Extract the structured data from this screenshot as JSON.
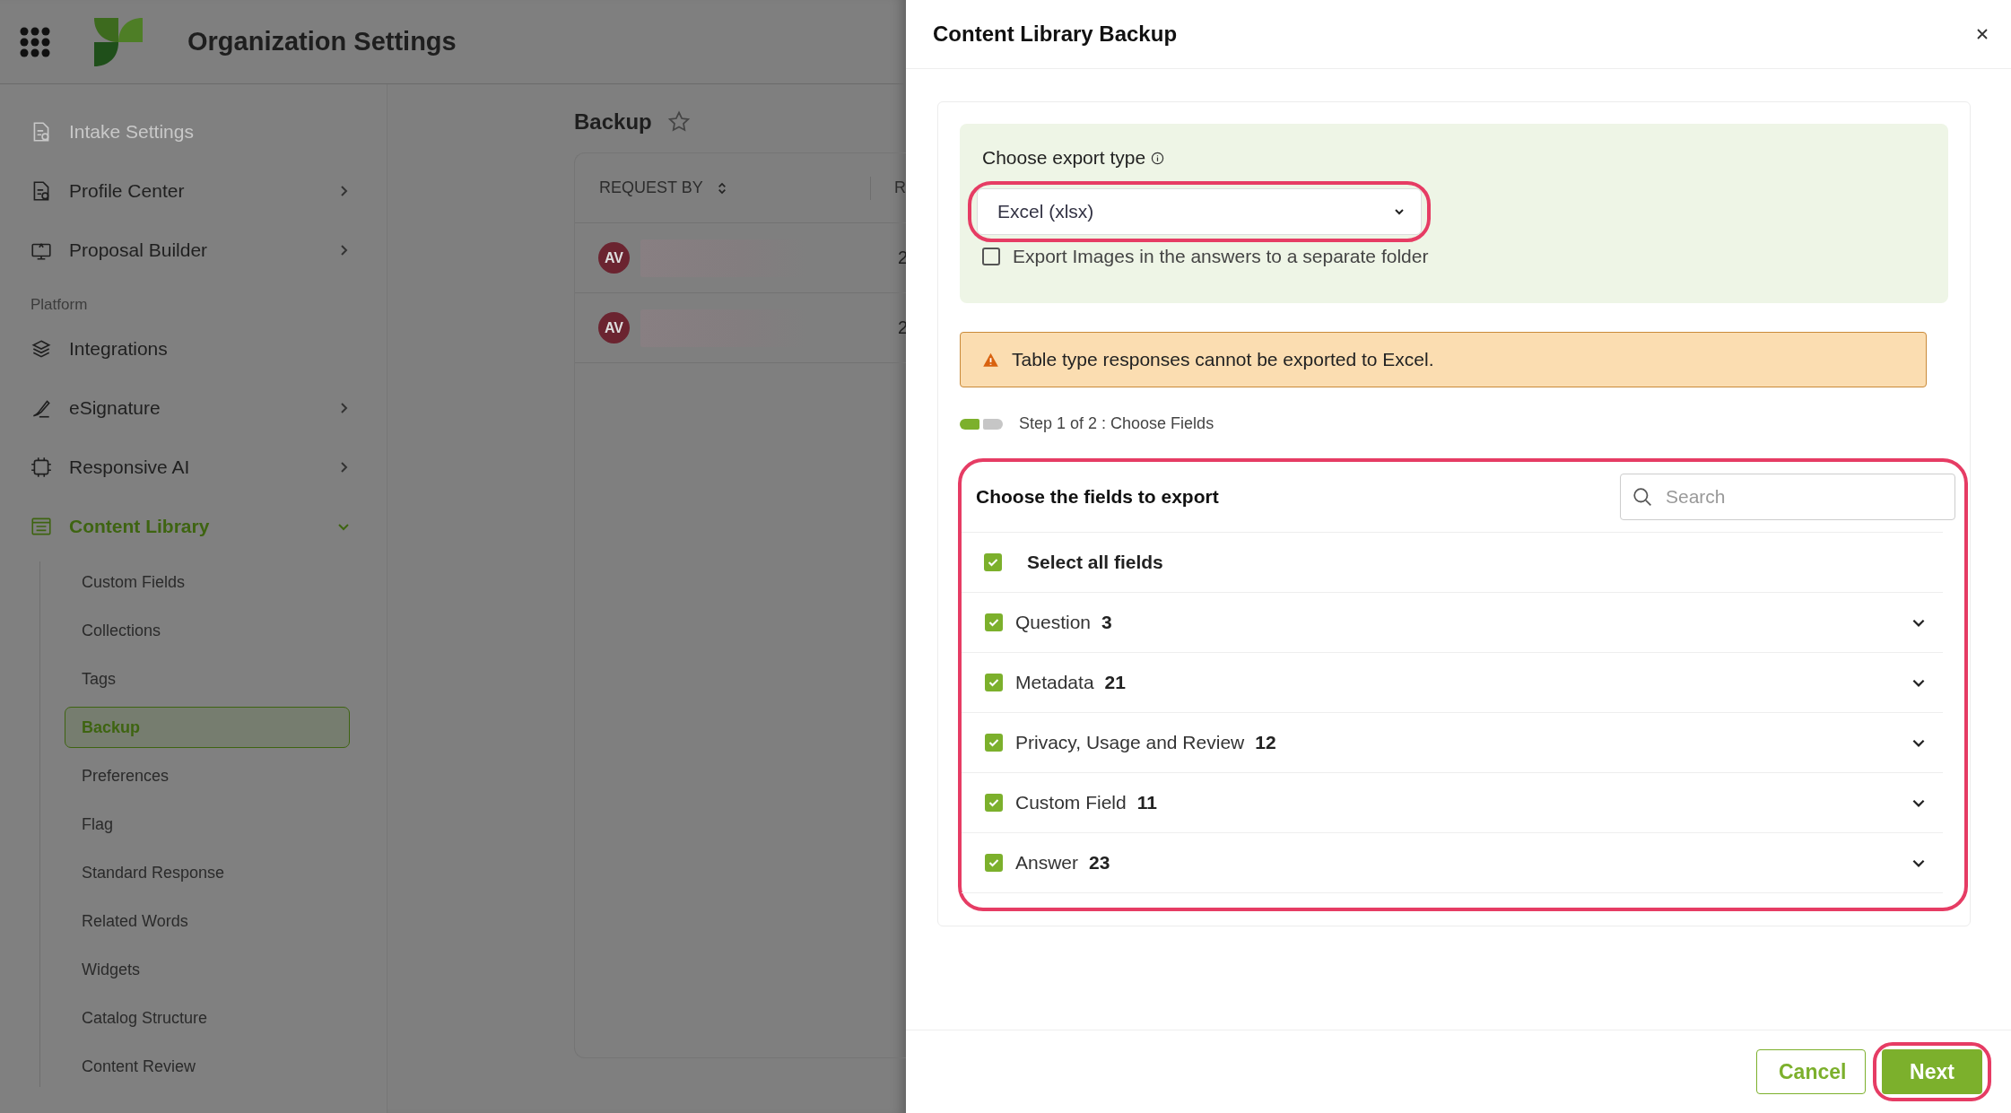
{
  "app_header": {
    "title": "Organization Settings"
  },
  "sidebar": {
    "items": [
      {
        "kind": "item",
        "label": "Intake Settings",
        "disabled": true,
        "expandable": false,
        "selected": false
      },
      {
        "kind": "item",
        "label": "Profile Center",
        "disabled": false,
        "expandable": true,
        "expanded": false,
        "selected": false
      },
      {
        "kind": "item",
        "label": "Proposal Builder",
        "disabled": false,
        "expandable": true,
        "expanded": false,
        "selected": false
      },
      {
        "kind": "section",
        "label": "Platform"
      },
      {
        "kind": "item",
        "label": "Integrations",
        "disabled": false,
        "expandable": false,
        "selected": false
      },
      {
        "kind": "item",
        "label": "eSignature",
        "disabled": false,
        "expandable": true,
        "expanded": false,
        "selected": false
      },
      {
        "kind": "item",
        "label": "Responsive AI",
        "disabled": false,
        "expandable": true,
        "expanded": false,
        "selected": false
      },
      {
        "kind": "item",
        "label": "Content Library",
        "disabled": false,
        "expandable": true,
        "expanded": true,
        "selected": true,
        "children": [
          {
            "label": "Custom Fields",
            "selected": false
          },
          {
            "label": "Collections",
            "selected": false
          },
          {
            "label": "Tags",
            "selected": false
          },
          {
            "label": "Backup",
            "selected": true
          },
          {
            "label": "Preferences",
            "selected": false
          },
          {
            "label": "Flag",
            "selected": false
          },
          {
            "label": "Standard Response",
            "selected": false
          },
          {
            "label": "Related Words",
            "selected": false
          },
          {
            "label": "Widgets",
            "selected": false
          },
          {
            "label": "Catalog Structure",
            "selected": false
          },
          {
            "label": "Content Review",
            "selected": false
          }
        ]
      }
    ]
  },
  "page": {
    "title": "Backup",
    "table": {
      "columns": [
        "REQUEST BY",
        "R"
      ],
      "rows": [
        {
          "avatar": "AV",
          "column_2": "2"
        },
        {
          "avatar": "AV",
          "column_2": "2"
        }
      ]
    }
  },
  "drawer": {
    "title": "Content Library Backup",
    "export_type": {
      "label": "Choose export type",
      "value": "Excel (xlsx)",
      "highlighted": true
    },
    "export_images": {
      "label": "Export Images in the answers to a separate folder",
      "checked": false
    },
    "warning": "Table type responses cannot be exported to Excel.",
    "step": {
      "label": "Step 1 of 2 : Choose Fields",
      "segments": [
        {
          "complete": true
        },
        {
          "complete": false
        }
      ]
    },
    "fields": {
      "title": "Choose the fields to export",
      "highlighted": true,
      "search": {
        "placeholder": "Search"
      },
      "select_all": {
        "label": "Select all fields",
        "checked": true
      },
      "groups": [
        {
          "label": "Question",
          "count": "3",
          "checked": true
        },
        {
          "label": "Metadata",
          "count": "21",
          "checked": true
        },
        {
          "label": "Privacy, Usage and Review",
          "count": "12",
          "checked": true
        },
        {
          "label": "Custom Field",
          "count": "11",
          "checked": true
        },
        {
          "label": "Answer",
          "count": "23",
          "checked": true
        }
      ]
    },
    "buttons": [
      {
        "kind": "secondary",
        "label": "Cancel",
        "highlighted": false
      },
      {
        "kind": "primary",
        "label": "Next",
        "highlighted": true
      }
    ]
  }
}
